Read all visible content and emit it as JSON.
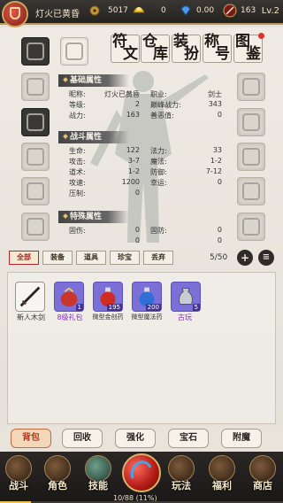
{
  "topbar": {
    "player_name": "灯火已黄昏",
    "copper": "5017",
    "gold": "0",
    "diamond": "0.00",
    "power": "163",
    "level": "Lv.2"
  },
  "side_tabs": [
    {
      "c1": "符",
      "c2": "文"
    },
    {
      "c1": "仓",
      "c2": "库"
    },
    {
      "c1": "装",
      "c2": "扮"
    },
    {
      "c1": "称",
      "c2": "号"
    },
    {
      "c1": "图",
      "c2": "鉴"
    }
  ],
  "basic": {
    "title": "基础属性",
    "rows": [
      {
        "k": "昵称:",
        "v": "灯火已黄昏",
        "k2": "职业:",
        "v2": "剑士"
      },
      {
        "k": "等级:",
        "v": "2",
        "k2": "巅峰战力:",
        "v2": "343"
      },
      {
        "k": "战力:",
        "v": "163",
        "k2": "善恶值:",
        "v2": "0"
      }
    ]
  },
  "combat": {
    "title": "战斗属性",
    "rows": [
      {
        "k": "生命:",
        "v": "122",
        "k2": "法力:",
        "v2": "33"
      },
      {
        "k": "攻击:",
        "v": "3-7",
        "k2": "魔法:",
        "v2": "1-2"
      },
      {
        "k": "道术:",
        "v": "1-2",
        "k2": "防御:",
        "v2": "7-12"
      },
      {
        "k": "攻速:",
        "v": "1200",
        "k2": "幸运:",
        "v2": "0"
      },
      {
        "k": "压制:",
        "v": "0",
        "k2": "",
        "v2": ""
      }
    ]
  },
  "special": {
    "title": "特殊属性",
    "rows": [
      {
        "k": "固伤:",
        "v": "0",
        "k2": "固防:",
        "v2": "0"
      },
      {
        "k": "",
        "v": "0",
        "k2": "",
        "v2": "0"
      }
    ]
  },
  "filters": [
    "全部",
    "装备",
    "道具",
    "珍宝",
    "丢弃"
  ],
  "page_indicator": "5/50",
  "items": [
    {
      "name": "新人木剑",
      "count": "",
      "color": "#333333"
    },
    {
      "name": "8级礼包",
      "count": "1",
      "color": "#8a2bd0"
    },
    {
      "name": "微型金创药",
      "count": "195",
      "color": "#333333"
    },
    {
      "name": "微型魔法药",
      "count": "200",
      "color": "#333333"
    },
    {
      "name": "古玩",
      "count": "5",
      "color": "#8a2bd0"
    }
  ],
  "actions": [
    "背包",
    "回收",
    "强化",
    "宝石",
    "附魔"
  ],
  "nav": [
    "战斗",
    "角色",
    "技能",
    "玩法",
    "福利",
    "商店"
  ],
  "exp_text": "10/88 (11%)",
  "exp_fraction": 0.11,
  "colors": {
    "accent_red": "#b4242a",
    "gold": "#c9a65a"
  }
}
